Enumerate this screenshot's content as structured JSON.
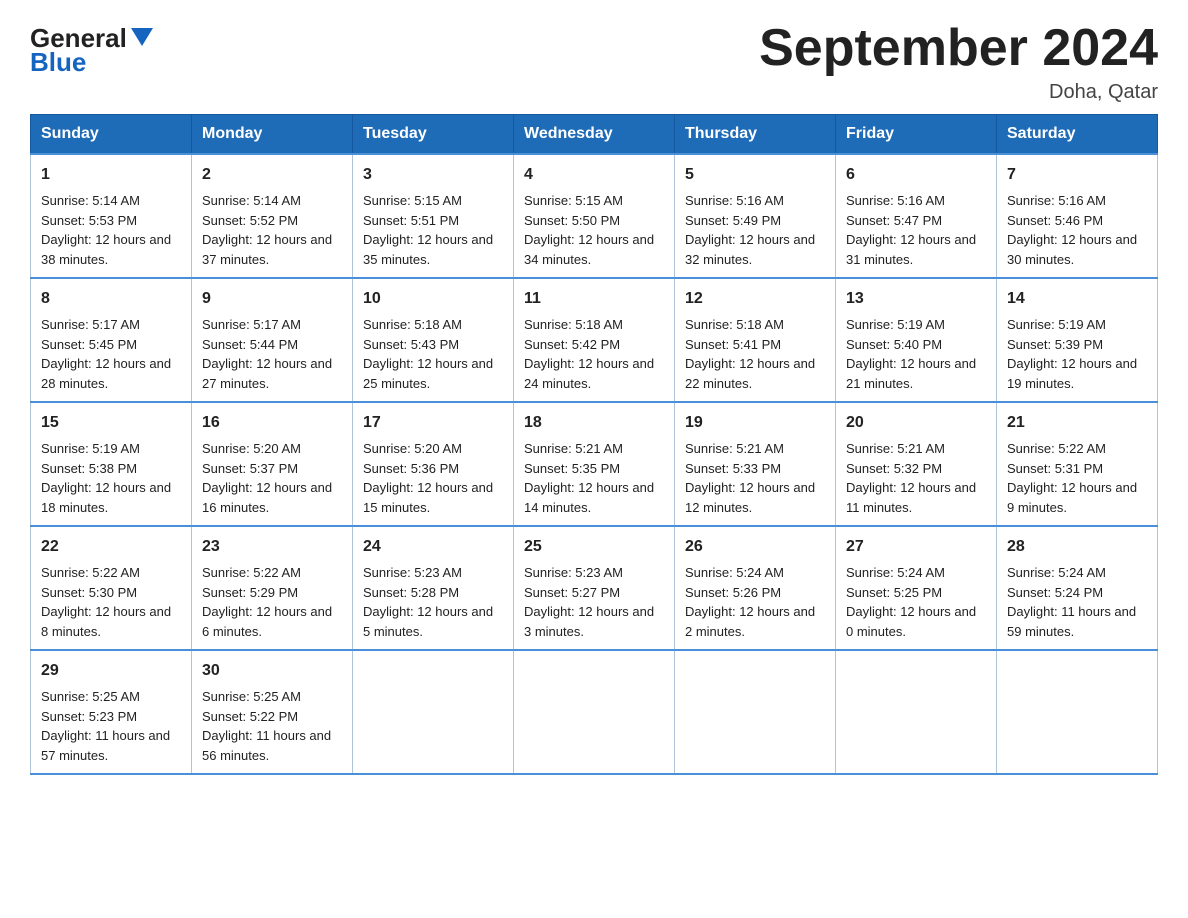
{
  "header": {
    "logo_general": "General",
    "logo_blue": "Blue",
    "title": "September 2024",
    "location": "Doha, Qatar"
  },
  "weekdays": [
    "Sunday",
    "Monday",
    "Tuesday",
    "Wednesday",
    "Thursday",
    "Friday",
    "Saturday"
  ],
  "weeks": [
    [
      {
        "day": "1",
        "sunrise": "5:14 AM",
        "sunset": "5:53 PM",
        "daylight": "12 hours and 38 minutes."
      },
      {
        "day": "2",
        "sunrise": "5:14 AM",
        "sunset": "5:52 PM",
        "daylight": "12 hours and 37 minutes."
      },
      {
        "day": "3",
        "sunrise": "5:15 AM",
        "sunset": "5:51 PM",
        "daylight": "12 hours and 35 minutes."
      },
      {
        "day": "4",
        "sunrise": "5:15 AM",
        "sunset": "5:50 PM",
        "daylight": "12 hours and 34 minutes."
      },
      {
        "day": "5",
        "sunrise": "5:16 AM",
        "sunset": "5:49 PM",
        "daylight": "12 hours and 32 minutes."
      },
      {
        "day": "6",
        "sunrise": "5:16 AM",
        "sunset": "5:47 PM",
        "daylight": "12 hours and 31 minutes."
      },
      {
        "day": "7",
        "sunrise": "5:16 AM",
        "sunset": "5:46 PM",
        "daylight": "12 hours and 30 minutes."
      }
    ],
    [
      {
        "day": "8",
        "sunrise": "5:17 AM",
        "sunset": "5:45 PM",
        "daylight": "12 hours and 28 minutes."
      },
      {
        "day": "9",
        "sunrise": "5:17 AM",
        "sunset": "5:44 PM",
        "daylight": "12 hours and 27 minutes."
      },
      {
        "day": "10",
        "sunrise": "5:18 AM",
        "sunset": "5:43 PM",
        "daylight": "12 hours and 25 minutes."
      },
      {
        "day": "11",
        "sunrise": "5:18 AM",
        "sunset": "5:42 PM",
        "daylight": "12 hours and 24 minutes."
      },
      {
        "day": "12",
        "sunrise": "5:18 AM",
        "sunset": "5:41 PM",
        "daylight": "12 hours and 22 minutes."
      },
      {
        "day": "13",
        "sunrise": "5:19 AM",
        "sunset": "5:40 PM",
        "daylight": "12 hours and 21 minutes."
      },
      {
        "day": "14",
        "sunrise": "5:19 AM",
        "sunset": "5:39 PM",
        "daylight": "12 hours and 19 minutes."
      }
    ],
    [
      {
        "day": "15",
        "sunrise": "5:19 AM",
        "sunset": "5:38 PM",
        "daylight": "12 hours and 18 minutes."
      },
      {
        "day": "16",
        "sunrise": "5:20 AM",
        "sunset": "5:37 PM",
        "daylight": "12 hours and 16 minutes."
      },
      {
        "day": "17",
        "sunrise": "5:20 AM",
        "sunset": "5:36 PM",
        "daylight": "12 hours and 15 minutes."
      },
      {
        "day": "18",
        "sunrise": "5:21 AM",
        "sunset": "5:35 PM",
        "daylight": "12 hours and 14 minutes."
      },
      {
        "day": "19",
        "sunrise": "5:21 AM",
        "sunset": "5:33 PM",
        "daylight": "12 hours and 12 minutes."
      },
      {
        "day": "20",
        "sunrise": "5:21 AM",
        "sunset": "5:32 PM",
        "daylight": "12 hours and 11 minutes."
      },
      {
        "day": "21",
        "sunrise": "5:22 AM",
        "sunset": "5:31 PM",
        "daylight": "12 hours and 9 minutes."
      }
    ],
    [
      {
        "day": "22",
        "sunrise": "5:22 AM",
        "sunset": "5:30 PM",
        "daylight": "12 hours and 8 minutes."
      },
      {
        "day": "23",
        "sunrise": "5:22 AM",
        "sunset": "5:29 PM",
        "daylight": "12 hours and 6 minutes."
      },
      {
        "day": "24",
        "sunrise": "5:23 AM",
        "sunset": "5:28 PM",
        "daylight": "12 hours and 5 minutes."
      },
      {
        "day": "25",
        "sunrise": "5:23 AM",
        "sunset": "5:27 PM",
        "daylight": "12 hours and 3 minutes."
      },
      {
        "day": "26",
        "sunrise": "5:24 AM",
        "sunset": "5:26 PM",
        "daylight": "12 hours and 2 minutes."
      },
      {
        "day": "27",
        "sunrise": "5:24 AM",
        "sunset": "5:25 PM",
        "daylight": "12 hours and 0 minutes."
      },
      {
        "day": "28",
        "sunrise": "5:24 AM",
        "sunset": "5:24 PM",
        "daylight": "11 hours and 59 minutes."
      }
    ],
    [
      {
        "day": "29",
        "sunrise": "5:25 AM",
        "sunset": "5:23 PM",
        "daylight": "11 hours and 57 minutes."
      },
      {
        "day": "30",
        "sunrise": "5:25 AM",
        "sunset": "5:22 PM",
        "daylight": "11 hours and 56 minutes."
      },
      null,
      null,
      null,
      null,
      null
    ]
  ],
  "labels": {
    "sunrise_prefix": "Sunrise: ",
    "sunset_prefix": "Sunset: ",
    "daylight_prefix": "Daylight: "
  }
}
